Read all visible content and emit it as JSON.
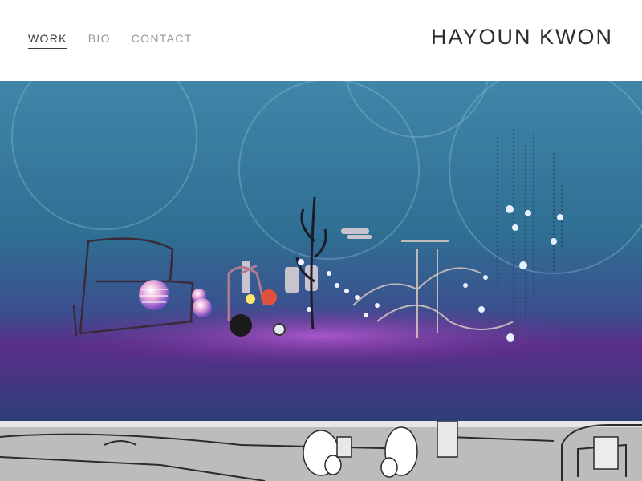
{
  "site": {
    "title": "HAYOUN KWON"
  },
  "nav": {
    "items": [
      {
        "label": "WORK",
        "active": true
      },
      {
        "label": "BIO",
        "active": false
      },
      {
        "label": "CONTACT",
        "active": false
      }
    ]
  },
  "gallery": {
    "items": [
      {
        "kind": "3d-installation-artwork"
      },
      {
        "kind": "line-drawing-train-interior"
      }
    ]
  },
  "colors": {
    "hero_top": "#3d7ea0",
    "hero_floor": "#6a2f8c",
    "text_dark": "#2d2d2d",
    "text_muted": "#9a9a9a"
  }
}
